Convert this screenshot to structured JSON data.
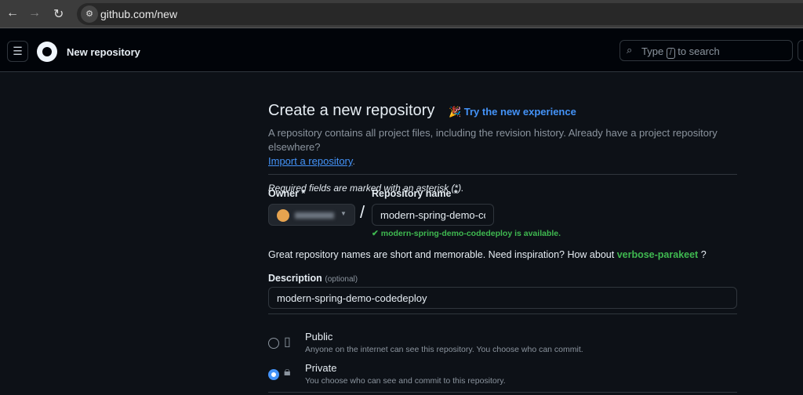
{
  "browser": {
    "url": "github.com/new"
  },
  "header": {
    "title": "New repository",
    "search_prefix": "Type",
    "search_key": "/",
    "search_suffix": "to search"
  },
  "page": {
    "title": "Create a new repository",
    "try_new": "Try the new experience",
    "subtitle": "A repository contains all project files, including the revision history. Already have a project repository elsewhere?",
    "import_link": "Import a repository",
    "required_note": "Required fields are marked with an asterisk (*).",
    "owner_label": "Owner *",
    "repo_label": "Repository name *",
    "repo_value": "modern-spring-demo-codedeploy",
    "available": "modern-spring-demo-codedeploy is available.",
    "inspiration": "Great repository names are short and memorable. Need inspiration? How about",
    "suggestion": "verbose-parakeet",
    "suggestion_end": "?",
    "desc_label": "Description",
    "desc_optional": "(optional)",
    "desc_value": "modern-spring-demo-codedeploy",
    "visibility": [
      {
        "name": "Public",
        "desc": "Anyone on the internet can see this repository. You choose who can commit.",
        "selected": false
      },
      {
        "name": "Private",
        "desc": "You choose who can see and commit to this repository.",
        "selected": true
      }
    ]
  }
}
